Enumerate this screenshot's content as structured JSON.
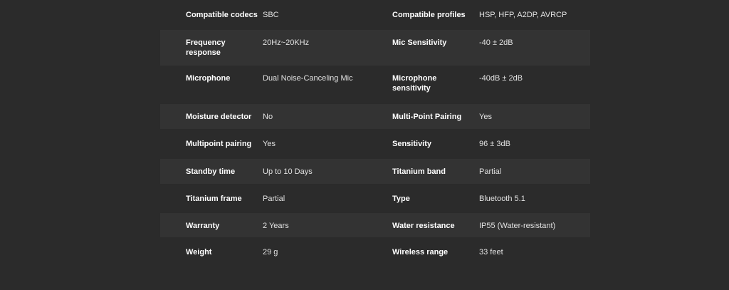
{
  "rows": [
    {
      "label_left": "Compatible codecs",
      "value_left": "SBC",
      "label_right": "Compatible profiles",
      "value_right": "HSP, HFP, A2DP, AVRCP"
    },
    {
      "label_left": "Frequency response",
      "value_left": "20Hz~20KHz",
      "label_right": "Mic Sensitivity",
      "value_right": "-40 ± 2dB"
    },
    {
      "label_left": "Microphone",
      "value_left": "Dual Noise-Canceling Mic",
      "label_right": "Microphone sensitivity",
      "value_right": "-40dB ± 2dB"
    },
    {
      "label_left": "Moisture detector",
      "value_left": "No",
      "label_right": "Multi-Point Pairing",
      "value_right": "Yes"
    },
    {
      "label_left": "Multipoint pairing",
      "value_left": "Yes",
      "label_right": "Sensitivity",
      "value_right": "96 ± 3dB"
    },
    {
      "label_left": "Standby time",
      "value_left": "Up to 10 Days",
      "label_right": "Titanium band",
      "value_right": "Partial"
    },
    {
      "label_left": "Titanium frame",
      "value_left": "Partial",
      "label_right": "Type",
      "value_right": "Bluetooth 5.1"
    },
    {
      "label_left": "Warranty",
      "value_left": "2 Years",
      "label_right": "Water resistance",
      "value_right": "IP55 (Water-resistant)"
    },
    {
      "label_left": "Weight",
      "value_left": "29 g",
      "label_right": "Wireless range",
      "value_right": "33 feet"
    }
  ]
}
